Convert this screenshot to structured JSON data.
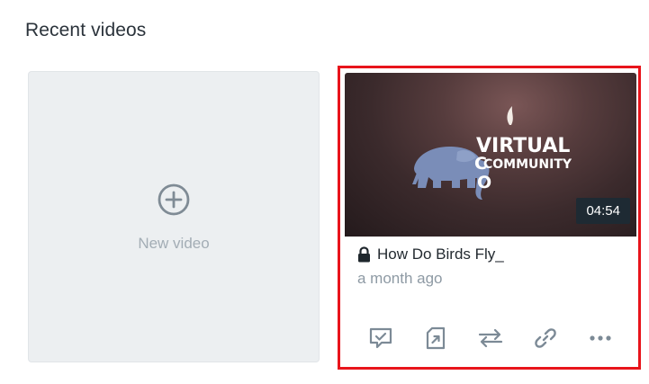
{
  "section": {
    "title": "Recent videos"
  },
  "new_video": {
    "label": "New video",
    "icon": "plus-circle-icon"
  },
  "video": {
    "title": "How Do Birds Fly_",
    "age": "a month ago",
    "duration": "04:54",
    "private_icon": "lock-icon",
    "thumbnail_text": {
      "line1": "VIRTUAL",
      "line2": "COMMUNITY",
      "letter_c": "C",
      "letter_o": "O"
    },
    "actions": [
      {
        "name": "comments-icon"
      },
      {
        "name": "open-external-icon"
      },
      {
        "name": "swap-icon"
      },
      {
        "name": "link-icon"
      },
      {
        "name": "more-icon"
      }
    ]
  },
  "colors": {
    "highlight_border": "#e8141b",
    "icon_gray": "#7c8a96",
    "text_dark": "#232a30",
    "text_muted": "#8e9aa4"
  }
}
